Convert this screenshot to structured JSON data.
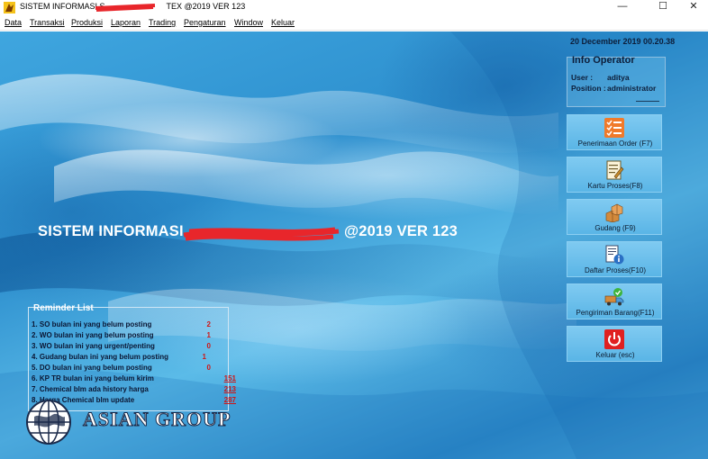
{
  "window": {
    "title": "SISTEM INFORMASI S",
    "title_suffix": "TEX @2019 VER 123",
    "controls": {
      "minimize": "—",
      "maximize": "☐",
      "close": "✕"
    }
  },
  "menu": {
    "items": [
      "Data",
      "Transaksi",
      "Produksi",
      "Laporan",
      "Trading",
      "Pengaturan",
      "Window",
      "Keluar"
    ]
  },
  "banner": {
    "title_start": "SISTEM INFORMASI",
    "title_end": "@2019 VER 123"
  },
  "status": {
    "datetime": "20 December 2019 00.20.38"
  },
  "operator": {
    "heading": "Info Operator",
    "user_label": "User :",
    "user_value": "aditya",
    "position_label": "Position :",
    "position_value": "administrator"
  },
  "actions": [
    {
      "label": "Penerimaan Order (F7)",
      "icon": "checklist-icon"
    },
    {
      "label": "Kartu Proses(F8)",
      "icon": "document-edit-icon"
    },
    {
      "label": "Gudang (F9)",
      "icon": "boxes-icon"
    },
    {
      "label": "Daftar Proses(F10)",
      "icon": "document-info-icon"
    },
    {
      "label": "Pengiriman Barang(F11)",
      "icon": "delivery-truck-icon"
    },
    {
      "label": "Keluar (esc)",
      "icon": "power-icon"
    }
  ],
  "reminder": {
    "heading": "Reminder List",
    "items": [
      {
        "label": "1. SO bulan ini yang belum posting",
        "value": "2"
      },
      {
        "label": "2. WO bulan ini yang belum posting",
        "value": "1"
      },
      {
        "label": "3. WO bulan ini yang urgent/penting",
        "value": "0"
      },
      {
        "label": "4. Gudang bulan ini  yang belum posting",
        "value": "1"
      },
      {
        "label": "5. DO bulan ini yang belum posting",
        "value": "0"
      },
      {
        "label": "6. KP TR bulan ini yang belum kirim",
        "value": "151"
      },
      {
        "label": "7. Chemical blm ada history harga",
        "value": "213"
      },
      {
        "label": "8. Harga Chemical blm update",
        "value": "287"
      }
    ]
  },
  "logo": {
    "text": "ASIAN GROUP"
  },
  "colors": {
    "accent_orange": "#f07a2a",
    "value_red": "#d01515",
    "power_red": "#e02020"
  }
}
